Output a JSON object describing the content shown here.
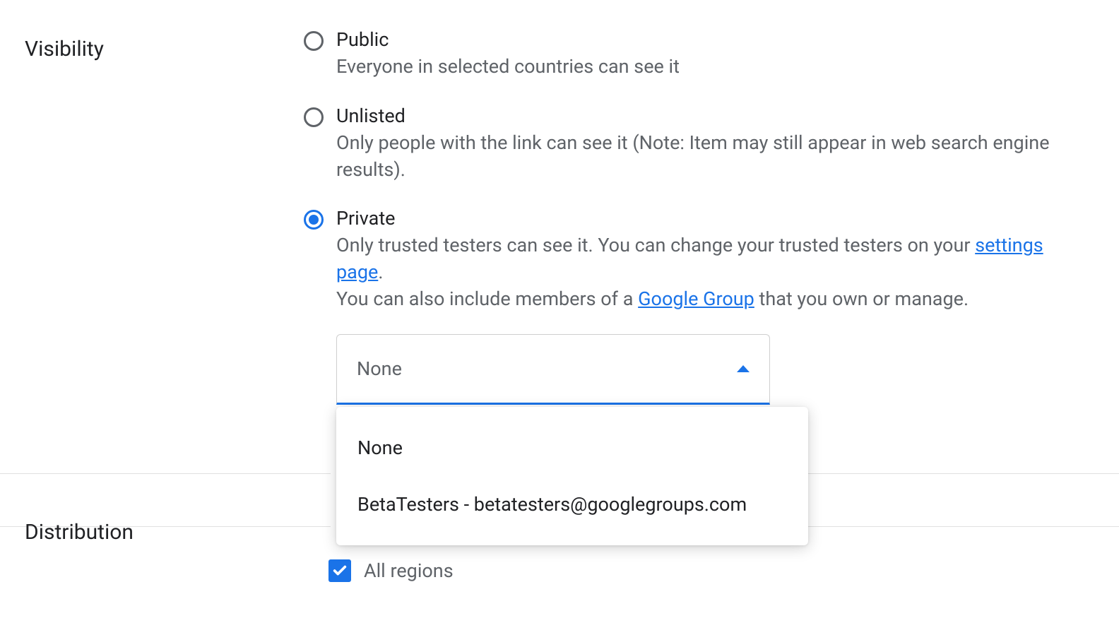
{
  "visibility": {
    "label": "Visibility",
    "options": [
      {
        "title": "Public",
        "desc": "Everyone in selected countries can see it",
        "selected": false
      },
      {
        "title": "Unlisted",
        "desc": "Only people with the link can see it (Note: Item may still appear in web search engine results).",
        "selected": false
      },
      {
        "title": "Private",
        "desc_pre": "Only trusted testers can see it. You can change your trusted testers on your ",
        "link1": "settings page",
        "desc_mid": ".",
        "desc_pre2": "You can also include members of a ",
        "link2": "Google Group",
        "desc_post": " that you own or manage.",
        "selected": true
      }
    ],
    "group_select": {
      "value": "None",
      "options": [
        "None",
        "BetaTesters - betatesters@googlegroups.com"
      ]
    }
  },
  "distribution": {
    "label": "Distribution",
    "all_regions_label": "All regions",
    "all_regions_checked": true
  }
}
